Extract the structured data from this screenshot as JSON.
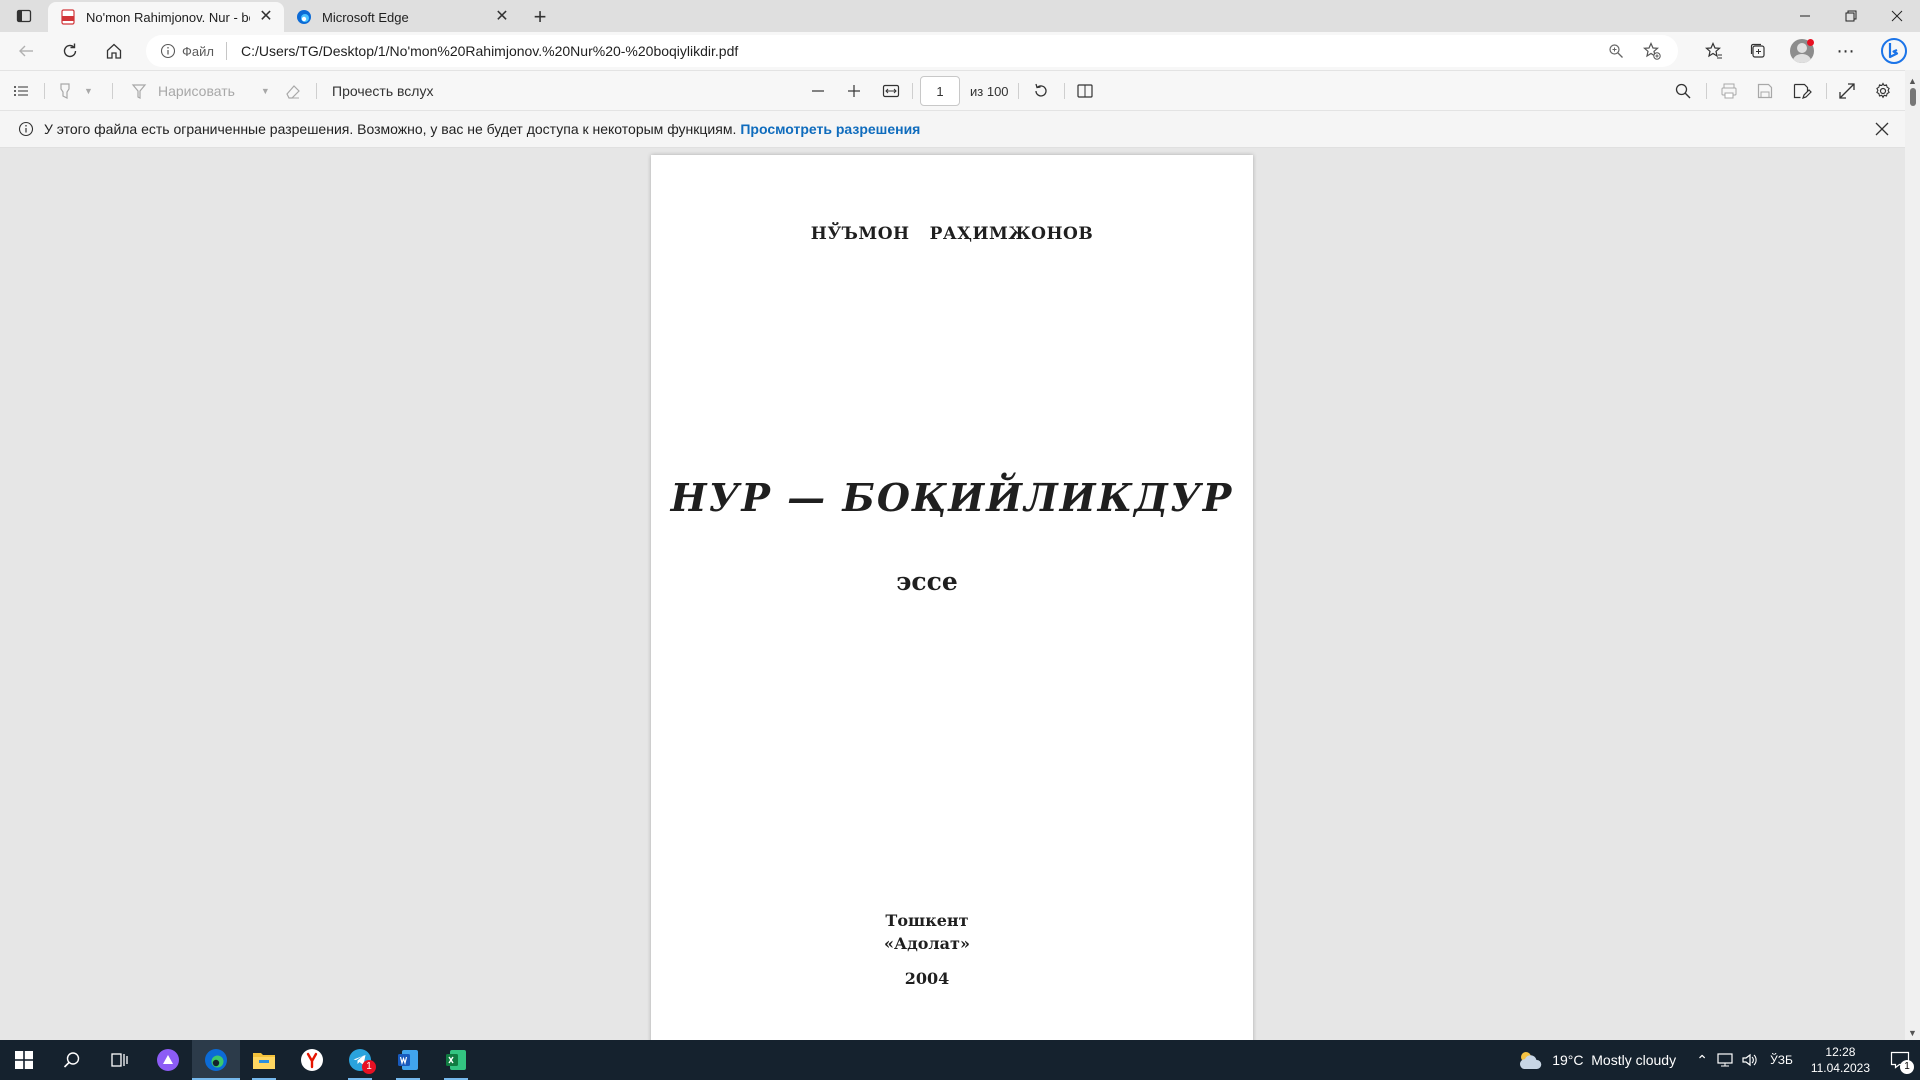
{
  "tabs": [
    {
      "title": "No'mon Rahimjonov. Nur - boqiylikdir.pdf",
      "active": true,
      "favicon": "pdf-file-icon"
    },
    {
      "title": "Microsoft Edge",
      "active": false,
      "favicon": "edge-logo-icon"
    }
  ],
  "address_bar": {
    "site_label": "Файл",
    "url": "C:/Users/TG/Desktop/1/No'mon%20Rahimjonov.%20Nur%20-%20boqiylikdir.pdf"
  },
  "pdf_toolbar": {
    "draw_label": "Нарисовать",
    "read_aloud_label": "Прочесть вслух",
    "page_number": "1",
    "page_total": "из 100"
  },
  "info_bar": {
    "message": "У этого файла есть ограниченные разрешения. Возможно, у вас не будет доступа к некоторым функциям.",
    "link": "Просмотреть разрешения"
  },
  "document": {
    "author_first": "НЎЪМОН",
    "author_last": "РАҲИМЖОНОВ",
    "title": "НУР — БОҚИЙЛИКДУР",
    "genre": "эссе",
    "city": "Тошкент",
    "publisher": "«Адолат»",
    "year": "2004"
  },
  "taskbar": {
    "weather": "19°C  Mostly cloudy",
    "language": "ЎЗБ",
    "time": "12:28",
    "date": "11.04.2023",
    "notifications": "1",
    "telegram_badge": "1"
  },
  "colors": {
    "link": "#0f6cbd",
    "taskbar": "#15222e",
    "pdf_red": "#d13438",
    "edge_blue": "#0c6bd6"
  }
}
